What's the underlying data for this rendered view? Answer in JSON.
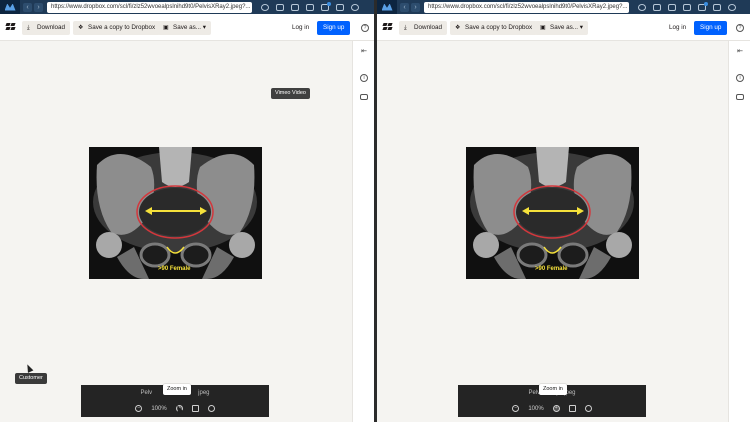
{
  "browser": {
    "url": "https://www.dropbox.com/scl/fi/zlz52wvoealpslnihd9t0/PelvisXRay2.jpeg?..."
  },
  "toolbar": {
    "download_label": "Download",
    "save_copy_label": "Save a copy to Dropbox",
    "save_as_label": "Save as...",
    "login_label": "Log in",
    "signup_label": "Sign up"
  },
  "viewer": {
    "file_name_left": "Pelv",
    "file_name_left_tail": "jpeg",
    "file_name_right": "PelvisXRay2.jpeg",
    "zoom_level": "100%",
    "xray_annotation": ">90 Female"
  },
  "tooltips": {
    "zoom_in": "Zoom in",
    "vimeo_video": "Vimeo Video",
    "customer": "Customer"
  },
  "colors": {
    "accent": "#0061fe",
    "annotation_arrow": "#f5e13b",
    "annotation_outline": "#d3373c"
  }
}
